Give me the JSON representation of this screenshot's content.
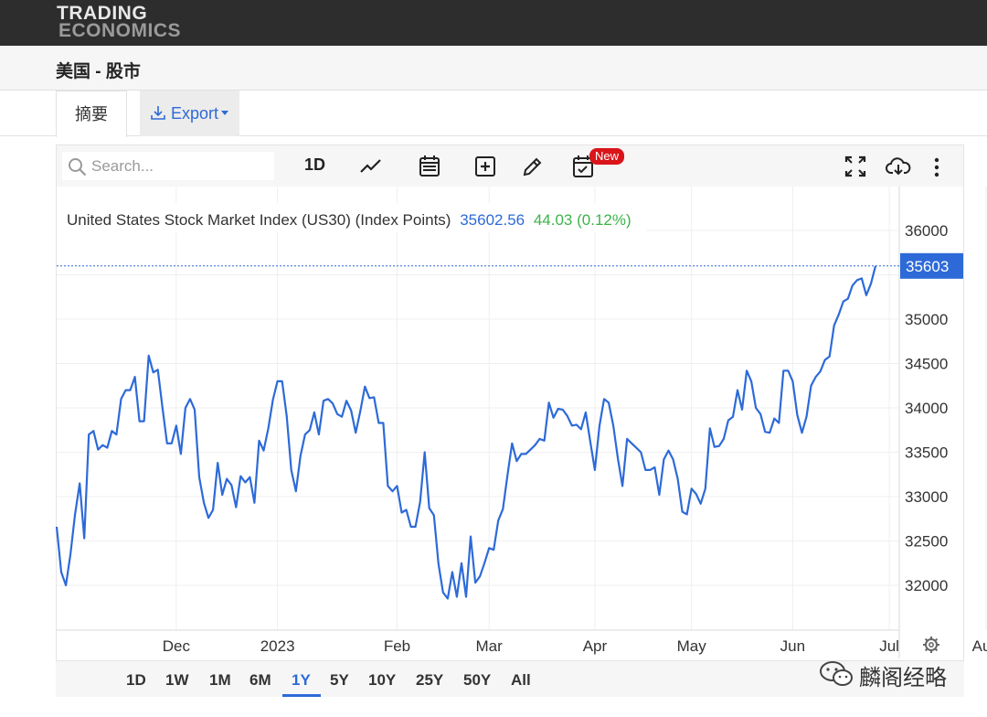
{
  "brand": {
    "line1": "TRADING",
    "line2": "ECONOMICS"
  },
  "page_title": "美国 - 股市",
  "tabs": {
    "summary": "摘要",
    "export": "Export"
  },
  "toolbar": {
    "search_placeholder": "Search...",
    "interval": "1D",
    "new_badge": "New"
  },
  "icons": [
    "search-icon",
    "line-chart-icon",
    "calendar-icon",
    "add-box-icon",
    "pencil-icon",
    "calendar-check-icon",
    "fullscreen-icon",
    "cloud-download-icon",
    "more-vertical-icon",
    "settings-icon",
    "wechat-icon"
  ],
  "ranges": [
    "1D",
    "1W",
    "1M",
    "6M",
    "1Y",
    "5Y",
    "10Y",
    "25Y",
    "50Y",
    "All"
  ],
  "active_range": "1Y",
  "watermark": "麟阁经略",
  "colors": {
    "line": "#2d6ad8",
    "change": "#3cb34a",
    "price_tag": "#2d6ad8"
  },
  "chart_data": {
    "type": "line",
    "title": "United States Stock Market Index (US30) (Index Points)",
    "last_value": "35602.56",
    "change": "44.03 (0.12%)",
    "last_label": "35603",
    "ylim": [
      31500,
      36500
    ],
    "yticks": [
      32000,
      32500,
      33000,
      33500,
      34000,
      34500,
      35000,
      35500,
      36000
    ],
    "ytick_labels": [
      "32000",
      "32500",
      "33000",
      "33500",
      "34000",
      "34500",
      "35000",
      "",
      "36000"
    ],
    "xticks": [
      {
        "label": "Dec",
        "x": 26
      },
      {
        "label": "2023",
        "x": 48
      },
      {
        "label": "Feb",
        "x": 74
      },
      {
        "label": "Mar",
        "x": 94
      },
      {
        "label": "Apr",
        "x": 117
      },
      {
        "label": "May",
        "x": 138
      },
      {
        "label": "Jun",
        "x": 160
      },
      {
        "label": "Jul",
        "x": 181
      },
      {
        "label": "Aug",
        "x": 202
      }
    ],
    "grid": true,
    "series": [
      {
        "values": [
          [
            0,
            32660
          ],
          [
            1,
            32150
          ],
          [
            2,
            32000
          ],
          [
            3,
            32350
          ],
          [
            4,
            32800
          ],
          [
            5,
            33150
          ],
          [
            6,
            32530
          ],
          [
            7,
            33700
          ],
          [
            8,
            33740
          ],
          [
            9,
            33530
          ],
          [
            10,
            33580
          ],
          [
            11,
            33550
          ],
          [
            12,
            33740
          ],
          [
            13,
            33700
          ],
          [
            14,
            34100
          ],
          [
            15,
            34200
          ],
          [
            16,
            34200
          ],
          [
            17,
            34350
          ],
          [
            18,
            33850
          ],
          [
            19,
            33850
          ],
          [
            20,
            34590
          ],
          [
            21,
            34400
          ],
          [
            22,
            34430
          ],
          [
            23,
            34000
          ],
          [
            24,
            33600
          ],
          [
            25,
            33600
          ],
          [
            26,
            33800
          ],
          [
            27,
            33480
          ],
          [
            28,
            34000
          ],
          [
            29,
            34100
          ],
          [
            30,
            33980
          ],
          [
            31,
            33220
          ],
          [
            32,
            32930
          ],
          [
            33,
            32760
          ],
          [
            34,
            32850
          ],
          [
            35,
            33380
          ],
          [
            36,
            33020
          ],
          [
            37,
            33200
          ],
          [
            38,
            33130
          ],
          [
            39,
            32880
          ],
          [
            40,
            33230
          ],
          [
            41,
            33160
          ],
          [
            42,
            33220
          ],
          [
            43,
            32930
          ],
          [
            44,
            33630
          ],
          [
            45,
            33520
          ],
          [
            46,
            33770
          ],
          [
            47,
            34090
          ],
          [
            48,
            34300
          ],
          [
            49,
            34300
          ],
          [
            50,
            33910
          ],
          [
            51,
            33300
          ],
          [
            52,
            33060
          ],
          [
            53,
            33460
          ],
          [
            54,
            33700
          ],
          [
            55,
            33750
          ],
          [
            56,
            33950
          ],
          [
            57,
            33700
          ],
          [
            58,
            34080
          ],
          [
            59,
            34100
          ],
          [
            60,
            34050
          ],
          [
            61,
            33930
          ],
          [
            62,
            33900
          ],
          [
            63,
            34080
          ],
          [
            64,
            33970
          ],
          [
            65,
            33720
          ],
          [
            66,
            33960
          ],
          [
            67,
            34240
          ],
          [
            68,
            34110
          ],
          [
            69,
            34120
          ],
          [
            70,
            33830
          ],
          [
            71,
            33830
          ],
          [
            72,
            33120
          ],
          [
            73,
            33060
          ],
          [
            74,
            33120
          ],
          [
            75,
            32820
          ],
          [
            76,
            32850
          ],
          [
            77,
            32660
          ],
          [
            78,
            32660
          ],
          [
            79,
            32940
          ],
          [
            80,
            33500
          ],
          [
            81,
            32870
          ],
          [
            82,
            32790
          ],
          [
            83,
            32240
          ],
          [
            84,
            31920
          ],
          [
            85,
            31850
          ],
          [
            86,
            32150
          ],
          [
            87,
            31870
          ],
          [
            88,
            32250
          ],
          [
            89,
            31870
          ],
          [
            90,
            32550
          ],
          [
            91,
            32030
          ],
          [
            92,
            32100
          ],
          [
            93,
            32250
          ],
          [
            94,
            32420
          ],
          [
            95,
            32400
          ],
          [
            96,
            32730
          ],
          [
            97,
            32860
          ],
          [
            98,
            33240
          ],
          [
            99,
            33600
          ],
          [
            100,
            33400
          ],
          [
            101,
            33480
          ],
          [
            102,
            33480
          ],
          [
            103,
            33530
          ],
          [
            104,
            33580
          ],
          [
            105,
            33650
          ],
          [
            106,
            33630
          ],
          [
            107,
            34060
          ],
          [
            108,
            33890
          ],
          [
            109,
            33990
          ],
          [
            110,
            33980
          ],
          [
            111,
            33910
          ],
          [
            112,
            33800
          ],
          [
            113,
            33810
          ],
          [
            114,
            33760
          ],
          [
            115,
            33950
          ],
          [
            116,
            33620
          ],
          [
            117,
            33300
          ],
          [
            118,
            33800
          ],
          [
            119,
            34100
          ],
          [
            120,
            34060
          ],
          [
            121,
            33800
          ],
          [
            122,
            33430
          ],
          [
            123,
            33120
          ],
          [
            124,
            33650
          ],
          [
            125,
            33600
          ],
          [
            126,
            33550
          ],
          [
            127,
            33500
          ],
          [
            128,
            33300
          ],
          [
            129,
            33300
          ],
          [
            130,
            33330
          ],
          [
            131,
            33020
          ],
          [
            132,
            33420
          ],
          [
            133,
            33520
          ],
          [
            134,
            33420
          ],
          [
            135,
            33200
          ],
          [
            136,
            32830
          ],
          [
            137,
            32800
          ],
          [
            138,
            33090
          ],
          [
            139,
            33030
          ],
          [
            140,
            32920
          ],
          [
            141,
            33090
          ],
          [
            142,
            33770
          ],
          [
            143,
            33560
          ],
          [
            144,
            33570
          ],
          [
            145,
            33650
          ],
          [
            146,
            33860
          ],
          [
            147,
            33900
          ],
          [
            148,
            34200
          ],
          [
            149,
            33980
          ],
          [
            150,
            34420
          ],
          [
            151,
            34300
          ],
          [
            152,
            34000
          ],
          [
            153,
            33930
          ],
          [
            154,
            33730
          ],
          [
            155,
            33720
          ],
          [
            156,
            33880
          ],
          [
            157,
            33830
          ],
          [
            158,
            34420
          ],
          [
            159,
            34420
          ],
          [
            160,
            34300
          ],
          [
            161,
            33920
          ],
          [
            162,
            33720
          ],
          [
            163,
            33900
          ],
          [
            164,
            34250
          ],
          [
            165,
            34350
          ],
          [
            166,
            34410
          ],
          [
            167,
            34540
          ],
          [
            168,
            34580
          ],
          [
            169,
            34930
          ],
          [
            170,
            35050
          ],
          [
            171,
            35200
          ],
          [
            172,
            35230
          ],
          [
            173,
            35380
          ],
          [
            174,
            35440
          ],
          [
            175,
            35460
          ],
          [
            176,
            35270
          ],
          [
            177,
            35400
          ],
          [
            178,
            35600
          ]
        ]
      }
    ]
  }
}
